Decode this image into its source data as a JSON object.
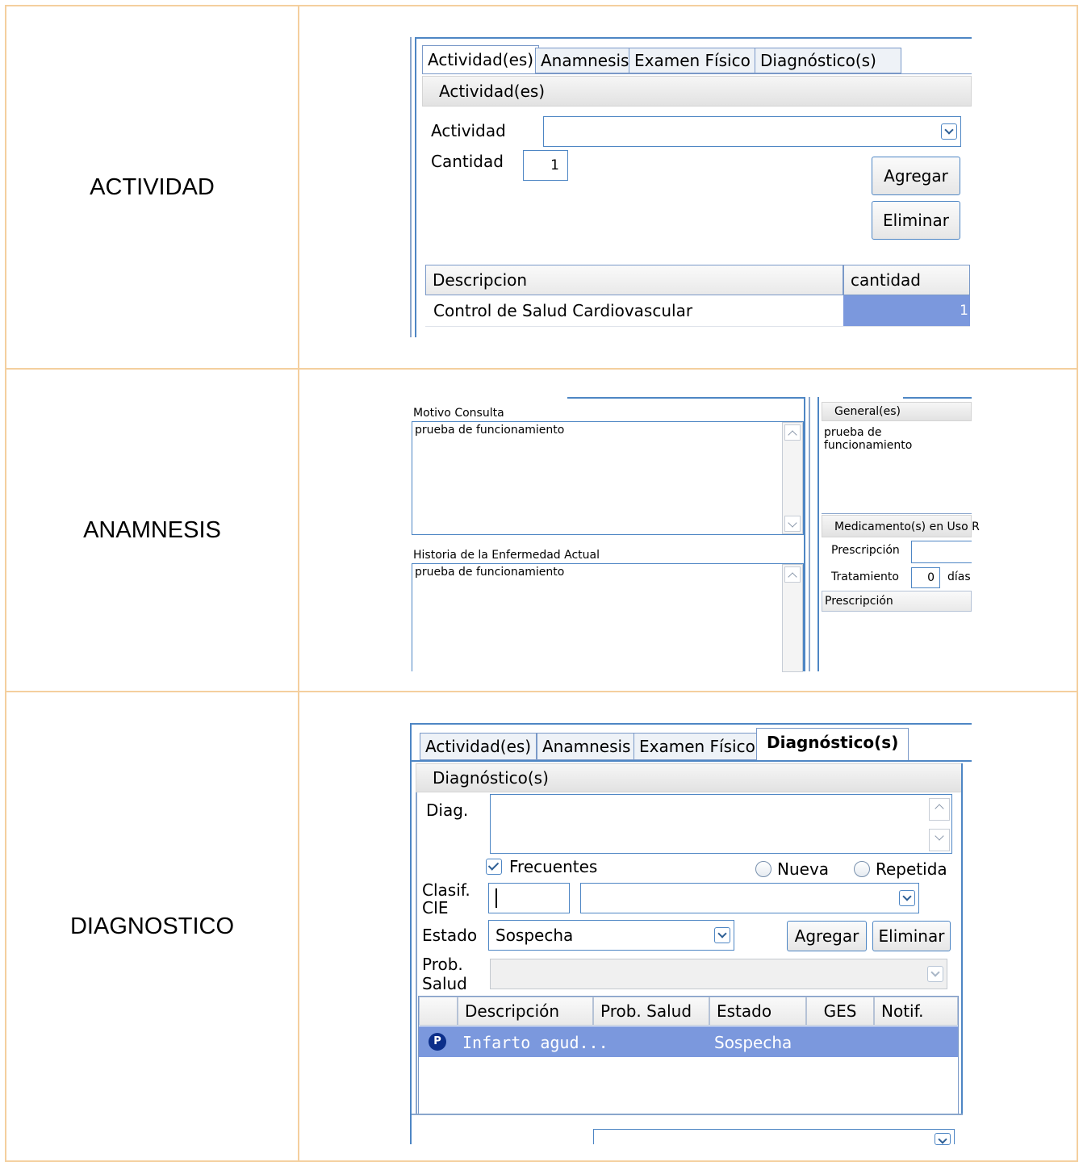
{
  "rows": [
    {
      "label": "ACTIVIDAD"
    },
    {
      "label": "ANAMNESIS"
    },
    {
      "label": "DIAGNOSTICO"
    }
  ],
  "actividad": {
    "tabs": [
      "Actividad(es)",
      "Anamnesis",
      "Examen Físico",
      "Diagnóstico(s)"
    ],
    "active_tab": "Actividad(es)",
    "section_title": "Actividad(es)",
    "actividad_label": "Actividad",
    "actividad_value": "",
    "cantidad_label": "Cantidad",
    "cantidad_value": "1",
    "agregar": "Agregar",
    "eliminar": "Eliminar",
    "table": {
      "columns": [
        "Descripcion",
        "cantidad"
      ],
      "rows": [
        {
          "descripcion": "Control de Salud Cardiovascular",
          "cantidad": "1"
        }
      ]
    },
    "selection_color": "#7b98dd"
  },
  "anamnesis": {
    "motivo_label": "Motivo Consulta",
    "motivo_text": "prueba de funcionamiento",
    "historia_label": "Historia de la Enfermedad Actual",
    "historia_text": "prueba de funcionamiento",
    "general_title": "General(es)",
    "general_text": "prueba de funcionamiento",
    "medicamentos_title": "Medicamento(s) en Uso R",
    "prescripcion_label": "Prescripción",
    "prescripcion_value": "",
    "tratamiento_label": "Tratamiento",
    "tratamiento_value": "0",
    "dias_label": "días",
    "grid_header": "Prescripción"
  },
  "diagnostico": {
    "tabs": [
      "Actividad(es)",
      "Anamnesis",
      "Examen Físico",
      "Diagnóstico(s)"
    ],
    "active_tab": "Diagnóstico(s)",
    "section_title": "Diagnóstico(s)",
    "diag_label": "Diag.",
    "diag_value": "",
    "frecuentes_label": "Frecuentes",
    "frecuentes_checked": true,
    "nueva_label": "Nueva",
    "repetida_label": "Repetida",
    "clasif_label_1": "Clasif.",
    "clasif_label_2": "CIE",
    "clasif_code": "",
    "clasif_desc": "",
    "estado_label": "Estado",
    "estado_value": "Sospecha",
    "agregar": "Agregar",
    "eliminar": "Eliminar",
    "prob_label_1": "Prob.",
    "prob_label_2": "Salud",
    "prob_value": "",
    "table": {
      "columns": [
        "",
        "Descripción",
        "Prob. Salud",
        "Estado",
        "GES",
        "Notif."
      ],
      "rows": [
        {
          "icon": "P",
          "descripcion": "Infarto agud...",
          "prob_salud": "",
          "estado": "Sospecha",
          "ges": "",
          "notif": ""
        }
      ]
    },
    "selection_color": "#7b98dd"
  }
}
